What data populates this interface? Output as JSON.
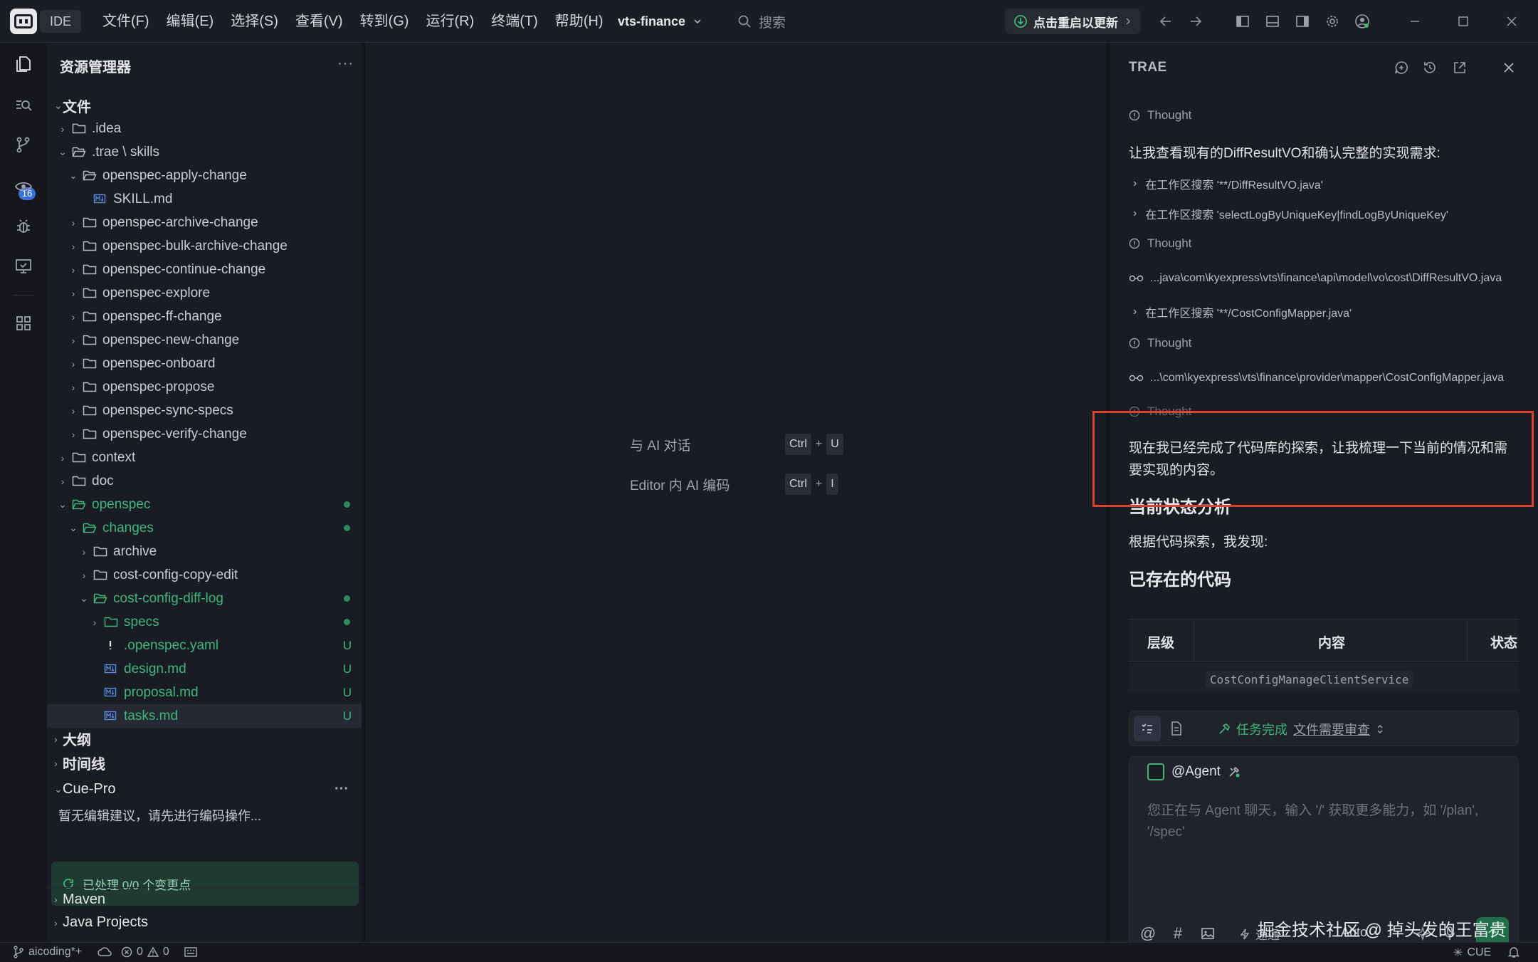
{
  "titlebar": {
    "ide_badge": "IDE",
    "menu": [
      "文件(F)",
      "编辑(E)",
      "选择(S)",
      "查看(V)",
      "转到(G)",
      "运行(R)",
      "终端(T)",
      "帮助(H)"
    ],
    "project": "vts-finance",
    "search_placeholder": "搜索",
    "update_label": "点击重启以更新"
  },
  "activitybar": {
    "scm_badge": "16"
  },
  "explorer": {
    "title": "资源管理器",
    "more": "···",
    "files_section": "文件",
    "tree": [
      {
        "label": ".idea",
        "depth": 1,
        "type": "folder",
        "expanded": false
      },
      {
        "label": ".trae \\ skills",
        "depth": 1,
        "type": "folder",
        "expanded": true
      },
      {
        "label": "openspec-apply-change",
        "depth": 2,
        "type": "folder",
        "expanded": true
      },
      {
        "label": "SKILL.md",
        "depth": 3,
        "type": "md"
      },
      {
        "label": "openspec-archive-change",
        "depth": 2,
        "type": "folder",
        "expanded": false
      },
      {
        "label": "openspec-bulk-archive-change",
        "depth": 2,
        "type": "folder",
        "expanded": false
      },
      {
        "label": "openspec-continue-change",
        "depth": 2,
        "type": "folder",
        "expanded": false
      },
      {
        "label": "openspec-explore",
        "depth": 2,
        "type": "folder",
        "expanded": false
      },
      {
        "label": "openspec-ff-change",
        "depth": 2,
        "type": "folder",
        "expanded": false
      },
      {
        "label": "openspec-new-change",
        "depth": 2,
        "type": "folder",
        "expanded": false
      },
      {
        "label": "openspec-onboard",
        "depth": 2,
        "type": "folder",
        "expanded": false
      },
      {
        "label": "openspec-propose",
        "depth": 2,
        "type": "folder",
        "expanded": false
      },
      {
        "label": "openspec-sync-specs",
        "depth": 2,
        "type": "folder",
        "expanded": false
      },
      {
        "label": "openspec-verify-change",
        "depth": 2,
        "type": "folder",
        "expanded": false
      },
      {
        "label": "context",
        "depth": 1,
        "type": "folder",
        "expanded": false
      },
      {
        "label": "doc",
        "depth": 1,
        "type": "folder",
        "expanded": false
      },
      {
        "label": "openspec",
        "depth": 1,
        "type": "folder",
        "expanded": true,
        "green": true,
        "dot": true
      },
      {
        "label": "changes",
        "depth": 2,
        "type": "folder",
        "expanded": true,
        "green": true,
        "dot": true
      },
      {
        "label": "archive",
        "depth": 3,
        "type": "folder",
        "expanded": false
      },
      {
        "label": "cost-config-copy-edit",
        "depth": 3,
        "type": "folder",
        "expanded": false
      },
      {
        "label": "cost-config-diff-log",
        "depth": 3,
        "type": "folder",
        "expanded": true,
        "green": true,
        "dot": true
      },
      {
        "label": "specs",
        "depth": 4,
        "type": "folder",
        "expanded": false,
        "green": true,
        "dot": true
      },
      {
        "label": ".openspec.yaml",
        "depth": 4,
        "type": "yaml",
        "green": true,
        "status": "U"
      },
      {
        "label": "design.md",
        "depth": 4,
        "type": "md",
        "green": true,
        "status": "U"
      },
      {
        "label": "proposal.md",
        "depth": 4,
        "type": "md",
        "green": true,
        "status": "U"
      },
      {
        "label": "tasks.md",
        "depth": 4,
        "type": "md",
        "green": true,
        "status": "U",
        "selected": true
      }
    ],
    "sections": {
      "outline": "大纲",
      "timeline": "时间线",
      "cue_pro": "Cue-Pro",
      "cue_more": "···",
      "cue_hint": "暂无编辑建议，请先进行编码操作...",
      "cue_processed": "已处理 0/0 个变更点",
      "maven": "Maven",
      "java_projects": "Java Projects"
    }
  },
  "editor": {
    "shortcuts": [
      {
        "label": "与 AI 对话",
        "keys": [
          "Ctrl",
          "U"
        ]
      },
      {
        "label": "Editor 内 AI 编码",
        "keys": [
          "Ctrl",
          "I"
        ]
      }
    ],
    "plus": "+"
  },
  "chat": {
    "title": "TRAE",
    "messages": {
      "thought": "Thought",
      "intro": "让我查看现有的DiffResultVO和确认完整的实现需求:",
      "search1": "在工作区搜索 '**/DiffResultVO.java'",
      "search2": "在工作区搜索 'selectLogByUniqueKey|findLogByUniqueKey'",
      "file1": "...java\\com\\kyexpress\\vts\\finance\\api\\model\\vo\\cost\\DiffResultVO.java",
      "search3": "在工作区搜索 '**/CostConfigMapper.java'",
      "file2": "...\\com\\kyexpress\\vts\\finance\\provider\\mapper\\CostConfigMapper.java",
      "summary_line1": "现在我已经完成了代码库的探索，让我梳理一下当前的情况和需",
      "summary_line2": "要实现的内容。",
      "h_status": "当前状态分析",
      "found": "根据代码探索，我发现:",
      "h_existing": "已存在的代码"
    },
    "table": {
      "headers": [
        "层级",
        "内容",
        "状态"
      ],
      "first_cell_code": "CostConfigManageClientService"
    },
    "task_bar": {
      "label": "任务完成",
      "link": "文件需要审查"
    },
    "input": {
      "agent": "@Agent",
      "placeholder": "您正在与 Agent 聊天，输入 '/' 获取更多能力，如 '/plan', '/spec'",
      "speed": "速通",
      "mode": "Auto"
    }
  },
  "watermark": "掘金技术社区 @ 掉头发的王富贵",
  "statusbar": {
    "branch": "aicoding*+",
    "errors": "0",
    "warnings": "0",
    "cue": "CUE"
  }
}
